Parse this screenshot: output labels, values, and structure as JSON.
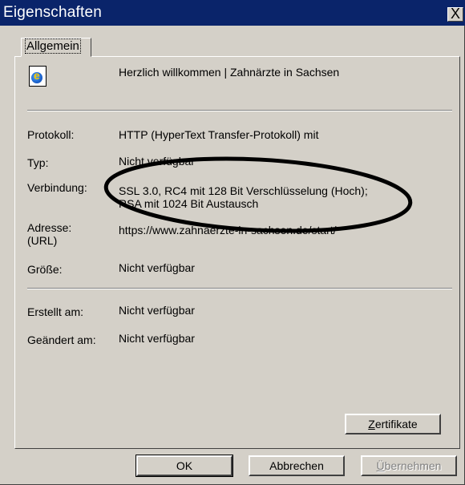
{
  "window": {
    "title": "Eigenschaften",
    "close_glyph": "X"
  },
  "tabs": [
    {
      "label": "Allgemein"
    }
  ],
  "page": {
    "title": "Herzlich willkommen | Zahnärzte in Sachsen",
    "icon": "ie-page-icon"
  },
  "properties": {
    "protocol": {
      "label": "Protokoll:",
      "value": "HTTP (HyperText Transfer-Protokoll) mit"
    },
    "type": {
      "label": "Typ:",
      "value": "Nicht verfügbar"
    },
    "connection": {
      "label": "Verbindung:",
      "value_line1": "SSL 3.0, RC4 mit 128 Bit Verschlüsselung (Hoch);",
      "value_line2": "RSA mit 1024 Bit Austausch"
    },
    "address": {
      "label_line1": "Adresse:",
      "label_line2": "(URL)",
      "value": "https://www.zahnaerzte-in-sachsen.de/start/"
    },
    "size": {
      "label": "Größe:",
      "value": "Nicht verfügbar"
    },
    "created": {
      "label": "Erstellt am:",
      "value": "Nicht verfügbar"
    },
    "modified": {
      "label": "Geändert am:",
      "value": "Nicht verfügbar"
    }
  },
  "buttons": {
    "certificates": {
      "hotkey": "Z",
      "rest": "ertifikate"
    },
    "ok": "OK",
    "cancel": "Abbrechen",
    "apply": {
      "hotkey": "Ü",
      "rest": "bernehmen"
    }
  },
  "colors": {
    "titlebar": "#0a246a",
    "dialog": "#d4d0c8",
    "annotation": "#000000"
  }
}
